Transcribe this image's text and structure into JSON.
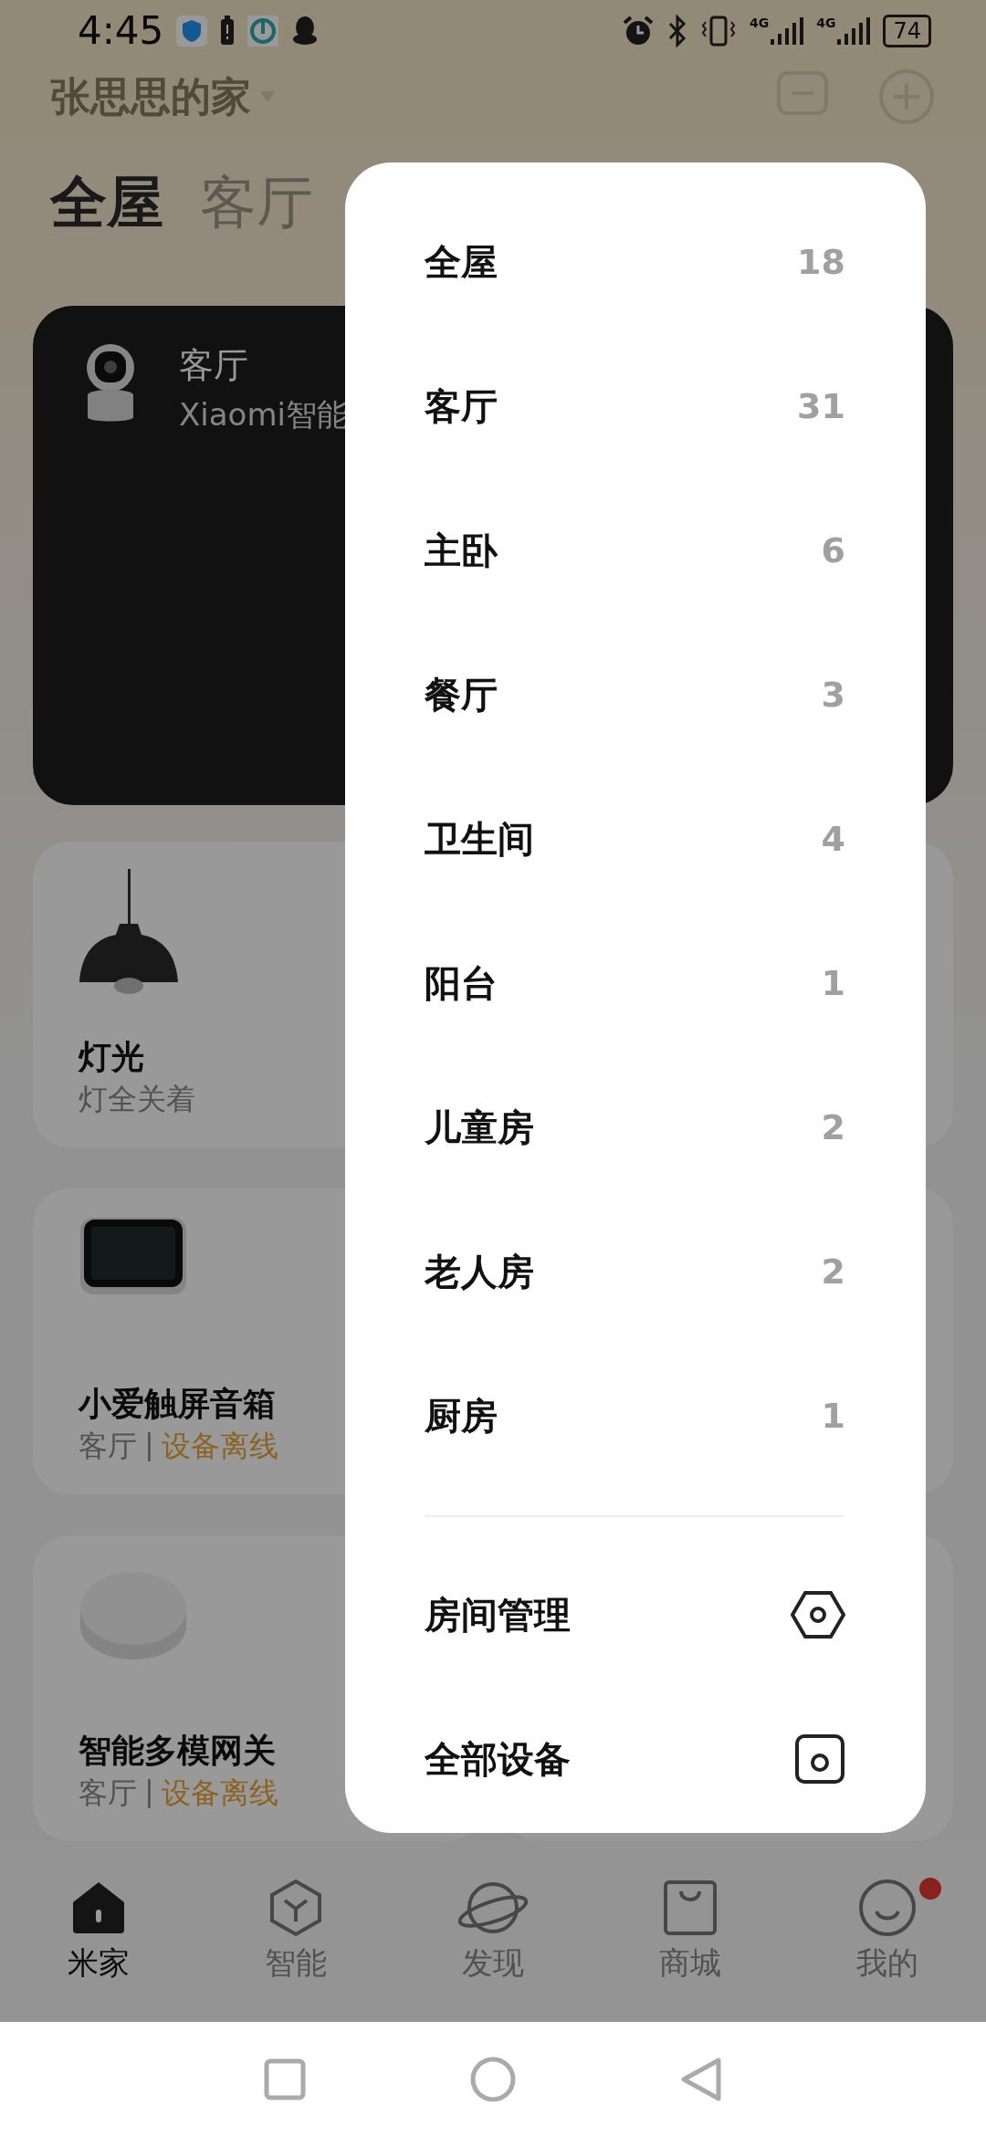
{
  "status_bar": {
    "time": "4:45",
    "network_labels": [
      "4G",
      "4G"
    ],
    "battery": "74"
  },
  "header": {
    "title": "张思思的家"
  },
  "tabs": [
    {
      "label": "全屋",
      "selected": true
    },
    {
      "label": "客厅",
      "selected": false
    }
  ],
  "camera_card": {
    "room": "客厅",
    "name": "Xiaomi智能"
  },
  "devices": [
    {
      "kind": "lamp",
      "name": "灯光",
      "subtitle": "灯全关着"
    },
    {
      "kind": "display",
      "name": "小爱触屏音箱",
      "room": "客厅",
      "separator": "|",
      "status": "设备离线"
    },
    {
      "kind": "hub",
      "name": "智能多模网关",
      "room": "客厅",
      "separator": "|",
      "status": "设备离线"
    }
  ],
  "room_menu": {
    "rooms": [
      {
        "name": "全屋",
        "count": "18"
      },
      {
        "name": "客厅",
        "count": "31"
      },
      {
        "name": "主卧",
        "count": "6"
      },
      {
        "name": "餐厅",
        "count": "3"
      },
      {
        "name": "卫生间",
        "count": "4"
      },
      {
        "name": "阳台",
        "count": "1"
      },
      {
        "name": "儿童房",
        "count": "2"
      },
      {
        "name": "老人房",
        "count": "2"
      },
      {
        "name": "厨房",
        "count": "1"
      }
    ],
    "actions": [
      {
        "kind": "manage",
        "label": "房间管理"
      },
      {
        "kind": "all",
        "label": "全部设备"
      }
    ]
  },
  "bottom_nav": [
    {
      "label": "米家",
      "selected": true,
      "badge": false
    },
    {
      "label": "智能",
      "selected": false,
      "badge": false
    },
    {
      "label": "发现",
      "selected": false,
      "badge": false
    },
    {
      "label": "商城",
      "selected": false,
      "badge": false
    },
    {
      "label": "我的",
      "selected": false,
      "badge": true
    }
  ]
}
